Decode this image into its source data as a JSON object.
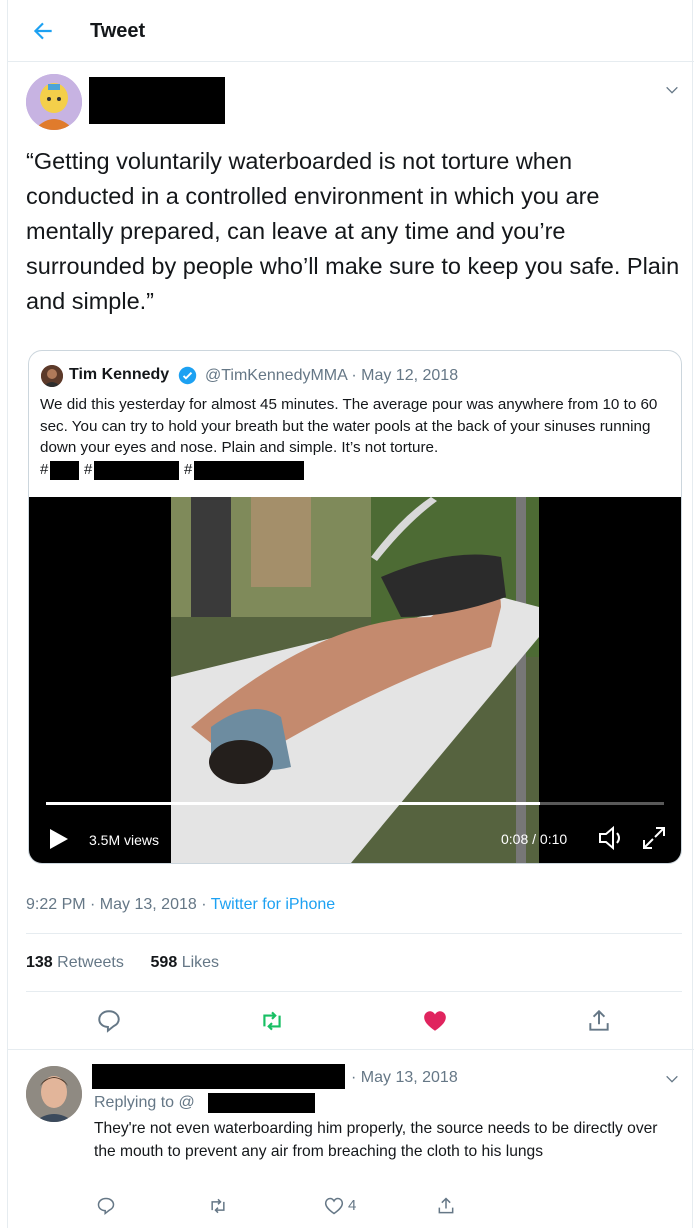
{
  "header": {
    "title": "Tweet"
  },
  "tweet": {
    "text": "“Getting voluntarily waterboarded is not torture when conducted in a controlled environment in which you are mentally prepared, can leave at any time and you’re surrounded by people who’ll make sure to keep you safe. Plain and simple.”",
    "time": "9:22 PM · May 13, 2018 · ",
    "source": "Twitter for iPhone",
    "retweets_count": "138",
    "retweets_label": "Retweets",
    "likes_count": "598",
    "likes_label": "Likes"
  },
  "quote": {
    "name": "Tim Kennedy",
    "handle_date": "@TimKennedyMMA · May 12, 2018",
    "text": "We did this yesterday for almost 45 minutes. The average pour was anywhere from 10 to 60 sec. You can try to hold your breath but the water pools at the back of your sinuses running down your eyes and nose. Plain and simple. It’s not torture.",
    "hash1": "#",
    "hash2": "#",
    "hash3": "#"
  },
  "video": {
    "views": "3.5M views",
    "time": "0:08 / 0:10",
    "progress_fraction": 0.8
  },
  "reply": {
    "date": "· May 13, 2018",
    "replying_to": "Replying to @",
    "text": "They're not even waterboarding him properly, the source needs to be directly over the mouth to prevent any air from breaching the cloth to his lungs",
    "likes": "4"
  },
  "colors": {
    "accent": "#1da1f2",
    "retweet": "#17bf63",
    "like": "#e0245e",
    "muted": "#657786"
  }
}
